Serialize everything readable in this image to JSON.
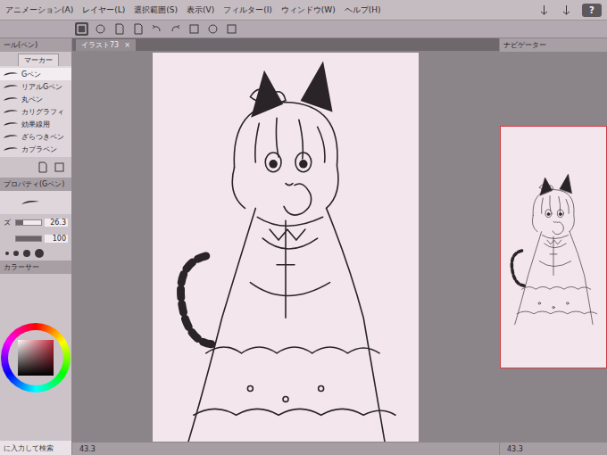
{
  "menu": [
    "アニメーション(A)",
    "レイヤー(L)",
    "選択範囲(S)",
    "表示(V)",
    "フィルター(I)",
    "ウィンドウ(W)",
    "ヘルプ(H)"
  ],
  "help_button": "?",
  "subtool_panel": {
    "title": "ール(ペン)",
    "tab": "マーカー",
    "items": [
      {
        "label": "Gペン",
        "selected": true
      },
      {
        "label": "リアルGペン",
        "selected": false
      },
      {
        "label": "丸ペン",
        "selected": false
      },
      {
        "label": "カリグラフィ",
        "selected": false
      },
      {
        "label": "効果線用",
        "selected": false
      },
      {
        "label": "ざらつきペン",
        "selected": false
      },
      {
        "label": "カブラペン",
        "selected": false
      }
    ]
  },
  "tool_property": {
    "title": "プロパティ(Gペン)",
    "size": {
      "label": "ズ",
      "value": "26.3",
      "level": 0.3
    },
    "opacity": {
      "value": "100",
      "level": 1
    }
  },
  "color_circle": {
    "title": "カラーサー",
    "current_color": "#c42a3c"
  },
  "canvas": {
    "tab": "イラスト73",
    "close": "×",
    "zoom": "43.3"
  },
  "navigator": {
    "title": "ナビゲーター",
    "zoom": "43.3"
  },
  "taskbar": {
    "search_placeholder": "に入力して検索"
  }
}
